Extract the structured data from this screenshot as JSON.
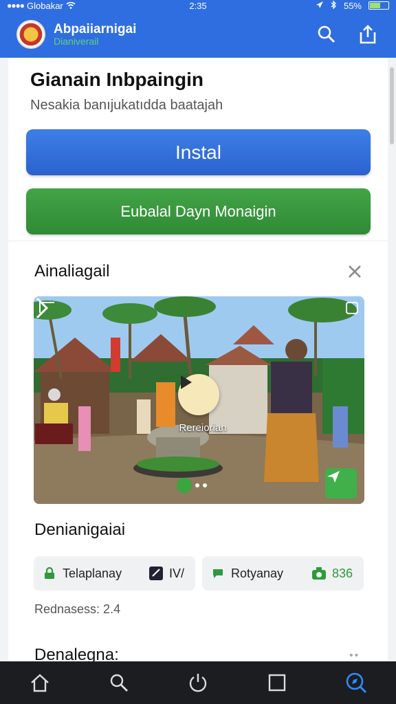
{
  "status": {
    "carrier": "Globakar",
    "time": "2:35",
    "battery": "55%",
    "battery_level": 0.55
  },
  "app": {
    "title": "Abpaiiarnigai",
    "subtitle": "Dianiverail"
  },
  "header": {
    "heading": "Gianain Inbpaingin",
    "subtitle": "Nesakia banıjukatıdda baatajah"
  },
  "buttons": {
    "install": "Instal",
    "secondary": "Eubalal Dayn Monaigin"
  },
  "card": {
    "title": "Ainaliagail",
    "media_caption": "Rereiorian",
    "section_title": "Denianigaiai",
    "chips": [
      {
        "label": "Telaplanay",
        "value": "IV/"
      },
      {
        "label": "Rotyanay",
        "value": "836"
      }
    ],
    "meta": "Rednasess: 2.4",
    "section2_title": "Denalegna:",
    "more": "••"
  },
  "colors": {
    "primary": "#2f6ee0",
    "green": "#3a9a3e",
    "nav_bg": "#1c1d20",
    "active": "#2f8cff"
  },
  "icons": {
    "search": "search-icon",
    "share": "share-icon",
    "close": "close-icon",
    "play": "play-icon"
  },
  "bottom_nav": [
    "home-icon",
    "search-icon",
    "power-icon",
    "square-icon",
    "discover-icon"
  ]
}
